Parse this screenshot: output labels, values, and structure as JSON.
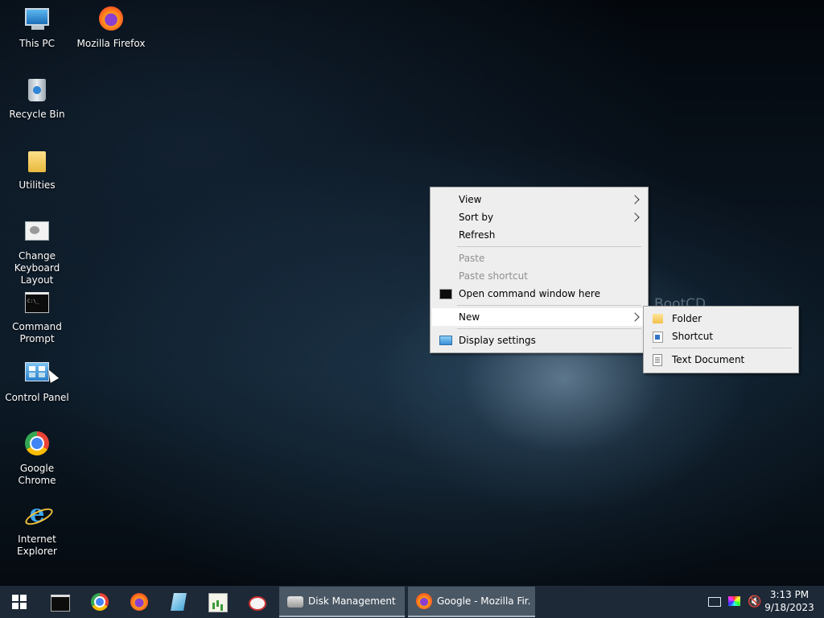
{
  "desktop": {
    "background_text": "BootCD",
    "icons": [
      {
        "label": "This PC",
        "icon": "computer-icon"
      },
      {
        "label": "Mozilla Firefox",
        "icon": "firefox-icon"
      },
      {
        "label": "Recycle Bin",
        "icon": "recycle-bin-icon"
      },
      {
        "label": "Utilities",
        "icon": "folder-icon"
      },
      {
        "label": "Change Keyboard Layout",
        "icon": "keyboard-layout-icon"
      },
      {
        "label": "Command Prompt",
        "icon": "command-prompt-icon"
      },
      {
        "label": "Control Panel",
        "icon": "control-panel-icon"
      },
      {
        "label": "Google Chrome",
        "icon": "chrome-icon"
      },
      {
        "label": "Internet Explorer",
        "icon": "internet-explorer-icon"
      }
    ]
  },
  "context_menu": {
    "items": [
      {
        "label": "View",
        "submenu": true
      },
      {
        "label": "Sort by",
        "submenu": true
      },
      {
        "label": "Refresh"
      },
      {
        "label": "Paste",
        "disabled": true
      },
      {
        "label": "Paste shortcut",
        "disabled": true
      },
      {
        "label": "Open command window here",
        "icon": "command-prompt-icon"
      },
      {
        "label": "New",
        "submenu": true,
        "highlighted": true
      },
      {
        "label": "Display settings",
        "icon": "display-icon"
      }
    ]
  },
  "new_submenu": {
    "items": [
      {
        "label": "Folder",
        "icon": "folder-icon"
      },
      {
        "label": "Shortcut",
        "icon": "shortcut-icon"
      },
      {
        "label": "Text Document",
        "icon": "text-document-icon"
      }
    ]
  },
  "taskbar": {
    "start_icon": "windows-logo-icon",
    "pinned": [
      "command-prompt-icon",
      "chrome-icon",
      "firefox-icon",
      "notepad-icon",
      "chart-app-icon",
      "snipping-tool-icon"
    ],
    "windows": [
      {
        "label": "Disk Management",
        "icon": "disk-management-icon"
      },
      {
        "label": "Google - Mozilla Fir...",
        "icon": "firefox-icon"
      }
    ],
    "tray_icons": [
      "network-icon",
      "display-color-icon",
      "volume-muted-icon"
    ],
    "clock": {
      "time": "3:13 PM",
      "date": "9/18/2023"
    },
    "volume_glyph": "🔇"
  },
  "colors": {
    "taskbar": "#1d2937",
    "menu_background": "#eeeeee",
    "menu_highlight": "#ffffff",
    "disabled_text": "#8f8f8f"
  }
}
